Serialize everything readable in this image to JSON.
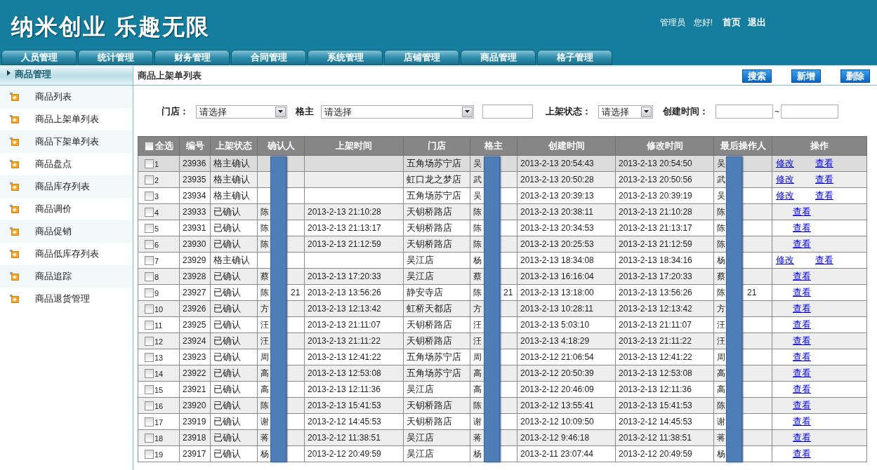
{
  "header": {
    "logo": "纳米创业 乐趣无限",
    "greeting": [
      "管理员",
      "您好!"
    ],
    "links": [
      "首页",
      "退出"
    ]
  },
  "nav_tabs": [
    "人员管理",
    "统计管理",
    "财务管理",
    "合同管理",
    "系统管理",
    "店铺管理",
    "商品管理",
    "格子管理"
  ],
  "sidebar": {
    "title": "商品管理",
    "items": [
      "商品列表",
      "商品上架单列表",
      "商品下架单列表",
      "商品盘点",
      "商品库存列表",
      "商品调价",
      "商品促销",
      "商品低库存列表",
      "商品追踪",
      "商品退货管理"
    ]
  },
  "page_title": "商品上架单列表",
  "toolbar_buttons": [
    "搜索",
    "新增",
    "删除"
  ],
  "filters": [
    {
      "kind": "select",
      "label": "门店：",
      "value": "请选择"
    },
    {
      "kind": "select",
      "label": "格主",
      "value": "请选择"
    },
    {
      "kind": "input"
    },
    {
      "kind": "select",
      "label": "上架状态：",
      "value": "请选择"
    },
    {
      "kind": "range",
      "label": "创建时间：",
      "separator": "~"
    }
  ],
  "table": {
    "select_all": {
      "label": "全选",
      "checked": false
    },
    "columns": [
      "编号",
      "上架状态",
      "确认人",
      "上架时间",
      "门店",
      "格主",
      "创建时间",
      "修改时间",
      "最后操作人",
      "操作"
    ],
    "rows": [
      {
        "no": "1",
        "checked": false,
        "highlighted": true,
        "id": "23936",
        "status": "格主确认",
        "confirmer": "",
        "shelf_time": "",
        "store": "五角场苏宁店",
        "owner": "吴",
        "created": "2013-2-13 20:54:43",
        "modified": "2013-2-13 20:54:50",
        "last_operator": "吴",
        "actions": [
          "修改",
          "查看"
        ]
      },
      {
        "no": "2",
        "checked": false,
        "highlighted": false,
        "id": "23935",
        "status": "格主确认",
        "confirmer": "",
        "shelf_time": "",
        "store": "虹口龙之梦店",
        "owner": "武",
        "created": "2013-2-13 20:50:28",
        "modified": "2013-2-13 20:50:56",
        "last_operator": "武",
        "actions": [
          "修改",
          "查看"
        ]
      },
      {
        "no": "3",
        "checked": false,
        "highlighted": false,
        "id": "23934",
        "status": "格主确认",
        "confirmer": "",
        "shelf_time": "",
        "store": "五角场苏宁店",
        "owner": "吴",
        "created": "2013-2-13 20:39:13",
        "modified": "2013-2-13 20:39:19",
        "last_operator": "吴",
        "actions": [
          "修改",
          "查看"
        ]
      },
      {
        "no": "4",
        "checked": false,
        "highlighted": false,
        "id": "23933",
        "status": "已确认",
        "confirmer": "陈",
        "shelf_time": "2013-2-13 21:10:28",
        "store": "天钥桥路店",
        "owner": "陈",
        "created": "2013-2-13 20:38:11",
        "modified": "2013-2-13 21:10:28",
        "last_operator": "陈",
        "actions": [
          "查看"
        ]
      },
      {
        "no": "5",
        "checked": false,
        "highlighted": false,
        "id": "23931",
        "status": "已确认",
        "confirmer": "陈",
        "shelf_time": "2013-2-13 21:13:17",
        "store": "天钥桥路店",
        "owner": "陈",
        "created": "2013-2-13 20:34:53",
        "modified": "2013-2-13 21:13:17",
        "last_operator": "陈",
        "actions": [
          "查看"
        ]
      },
      {
        "no": "6",
        "checked": false,
        "highlighted": false,
        "id": "23930",
        "status": "已确认",
        "confirmer": "陈",
        "shelf_time": "2013-2-13 21:12:59",
        "store": "天钥桥路店",
        "owner": "陈",
        "created": "2013-2-13 20:25:53",
        "modified": "2013-2-13 21:12:59",
        "last_operator": "陈",
        "actions": [
          "查看"
        ]
      },
      {
        "no": "7",
        "checked": false,
        "highlighted": false,
        "id": "23929",
        "status": "格主确认",
        "confirmer": "",
        "shelf_time": "",
        "store": "吴江店",
        "owner": "杨",
        "created": "2013-2-13 18:34:08",
        "modified": "2013-2-13 18:34:16",
        "last_operator": "杨",
        "actions": [
          "修改",
          "查看"
        ]
      },
      {
        "no": "8",
        "checked": false,
        "highlighted": false,
        "id": "23928",
        "status": "已确认",
        "confirmer": "蔡",
        "shelf_time": "2013-2-13 17:20:33",
        "store": "吴江店",
        "owner": "蔡",
        "created": "2013-2-13 16:16:04",
        "modified": "2013-2-13 17:20:33",
        "last_operator": "蔡",
        "actions": [
          "查看"
        ]
      },
      {
        "no": "9",
        "checked": false,
        "highlighted": false,
        "id": "23927",
        "status": "已确认",
        "confirmer": "陈",
        "confirmer_suffix": "21",
        "shelf_time": "2013-2-13 13:56:26",
        "store": "静安寺店",
        "owner": "陈",
        "owner_suffix": "21",
        "created": "2013-2-13 13:18:00",
        "modified": "2013-2-13 13:56:26",
        "last_operator": "陈",
        "last_operator_suffix": "21",
        "actions": [
          "查看"
        ]
      },
      {
        "no": "10",
        "checked": false,
        "highlighted": false,
        "id": "23926",
        "status": "已确认",
        "confirmer": "方",
        "shelf_time": "2013-2-13 12:13:42",
        "store": "虹桥天都店",
        "owner": "方",
        "created": "2013-2-13 10:28:11",
        "modified": "2013-2-13 12:13:42",
        "last_operator": "方",
        "actions": [
          "查看"
        ]
      },
      {
        "no": "11",
        "checked": false,
        "highlighted": false,
        "id": "23925",
        "status": "已确认",
        "confirmer": "汪",
        "shelf_time": "2013-2-13 21:11:07",
        "store": "天钥桥路店",
        "owner": "汪",
        "created": "2013-2-13 5:03:10",
        "modified": "2013-2-13 21:11:07",
        "last_operator": "汪",
        "actions": [
          "查看"
        ]
      },
      {
        "no": "12",
        "checked": false,
        "highlighted": false,
        "id": "23924",
        "status": "已确认",
        "confirmer": "汪",
        "shelf_time": "2013-2-13 21:11:22",
        "store": "天钥桥路店",
        "owner": "汪",
        "created": "2013-2-13 4:18:29",
        "modified": "2013-2-13 21:11:22",
        "last_operator": "汪",
        "actions": [
          "查看"
        ]
      },
      {
        "no": "13",
        "checked": false,
        "highlighted": false,
        "id": "23923",
        "status": "已确认",
        "confirmer": "周",
        "shelf_time": "2013-2-13 12:41:22",
        "store": "五角场苏宁店",
        "owner": "周",
        "created": "2013-2-12 21:06:54",
        "modified": "2013-2-13 12:41:22",
        "last_operator": "周",
        "actions": [
          "查看"
        ]
      },
      {
        "no": "14",
        "checked": false,
        "highlighted": false,
        "id": "23922",
        "status": "已确认",
        "confirmer": "高",
        "shelf_time": "2013-2-13 12:53:08",
        "store": "五角场苏宁店",
        "owner": "高",
        "created": "2013-2-12 20:50:39",
        "modified": "2013-2-13 12:53:08",
        "last_operator": "高",
        "actions": [
          "查看"
        ]
      },
      {
        "no": "15",
        "checked": false,
        "highlighted": false,
        "id": "23921",
        "status": "已确认",
        "confirmer": "高",
        "shelf_time": "2013-2-13 12:11:36",
        "store": "吴江店",
        "owner": "高",
        "created": "2013-2-12 20:46:09",
        "modified": "2013-2-13 12:11:36",
        "last_operator": "高",
        "actions": [
          "查看"
        ]
      },
      {
        "no": "16",
        "checked": false,
        "highlighted": false,
        "id": "23920",
        "status": "已确认",
        "confirmer": "陈",
        "shelf_time": "2013-2-13 15:41:53",
        "store": "天钥桥路店",
        "owner": "陈",
        "created": "2013-2-12 13:55:41",
        "modified": "2013-2-13 15:41:53",
        "last_operator": "陈",
        "actions": [
          "查看"
        ]
      },
      {
        "no": "17",
        "checked": false,
        "highlighted": false,
        "id": "23919",
        "status": "已确认",
        "confirmer": "谢",
        "shelf_time": "2013-2-12 14:45:53",
        "store": "天钥桥路店",
        "owner": "谢",
        "created": "2013-2-12 10:09:50",
        "modified": "2013-2-12 14:45:53",
        "last_operator": "谢",
        "actions": [
          "查看"
        ]
      },
      {
        "no": "18",
        "checked": false,
        "highlighted": false,
        "id": "23918",
        "status": "已确认",
        "confirmer": "蒋",
        "shelf_time": "2013-2-12 11:38:51",
        "store": "吴江店",
        "owner": "蒋",
        "created": "2013-2-12 9:46:18",
        "modified": "2013-2-12 11:38:51",
        "last_operator": "蒋",
        "actions": [
          "查看"
        ]
      },
      {
        "no": "19",
        "checked": false,
        "highlighted": false,
        "id": "23917",
        "status": "已确认",
        "confirmer": "杨",
        "shelf_time": "2013-2-12 20:49:59",
        "store": "吴江店",
        "owner": "杨",
        "created": "2013-2-11 23:07:44",
        "modified": "2013-2-12 20:49:59",
        "last_operator": "杨",
        "actions": [
          "查看"
        ]
      }
    ]
  }
}
